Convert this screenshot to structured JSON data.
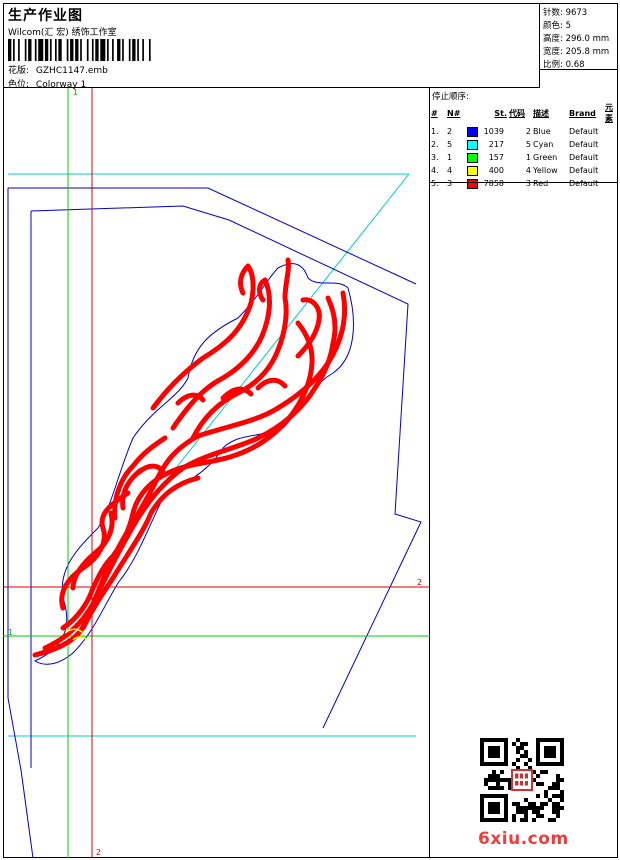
{
  "header": {
    "title": "生产作业图",
    "studio": "Wilcom(汇 宏) 绣饰工作室",
    "design_label": "花版:",
    "design_value": "GZHC1147.emb",
    "colorway_label": "色位:",
    "colorway_value": "Colorway 1"
  },
  "stats": [
    {
      "label": "针数:",
      "value": "9673"
    },
    {
      "label": "颜色:",
      "value": "5"
    },
    {
      "label": "高度:",
      "value": "296.0 mm"
    },
    {
      "label": "宽度:",
      "value": "205.8 mm"
    },
    {
      "label": "比例:",
      "value": "0.68"
    }
  ],
  "stop_sequence": {
    "title": "停止顺序:",
    "headers": [
      "#",
      "N#",
      "St.",
      "代码",
      "描述",
      "Brand",
      "元素"
    ],
    "rows": [
      {
        "index": "1.",
        "n": "2",
        "color": "#0000ff",
        "stitches": "1039",
        "code": "2",
        "desc": "Blue",
        "brand": "Default",
        "element": ""
      },
      {
        "index": "2.",
        "n": "5",
        "color": "#00ffff",
        "stitches": "217",
        "code": "5",
        "desc": "Cyan",
        "brand": "Default",
        "element": ""
      },
      {
        "index": "3.",
        "n": "1",
        "color": "#00ff00",
        "stitches": "157",
        "code": "1",
        "desc": "Green",
        "brand": "Default",
        "element": ""
      },
      {
        "index": "4.",
        "n": "4",
        "color": "#ffff00",
        "stitches": "400",
        "code": "4",
        "desc": "Yellow",
        "brand": "Default",
        "element": ""
      },
      {
        "index": "5.",
        "n": "3",
        "color": "#ff0000",
        "stitches": "7858",
        "code": "3",
        "desc": "Red",
        "brand": "Default",
        "element": ""
      }
    ]
  },
  "guides": {
    "green_label_top": "1",
    "green_label_left": "1",
    "red_label_right": "2",
    "red_label_bottom": "2"
  },
  "watermark": {
    "site": "6xiu.com",
    "qr_icon": "qr-code-icon"
  },
  "colors": {
    "red_guide": "#e00000",
    "green_guide": "#00cc00",
    "blue_outline": "#0000cc",
    "cyan_outline": "#00cccc",
    "design_red": "#ff0000"
  }
}
